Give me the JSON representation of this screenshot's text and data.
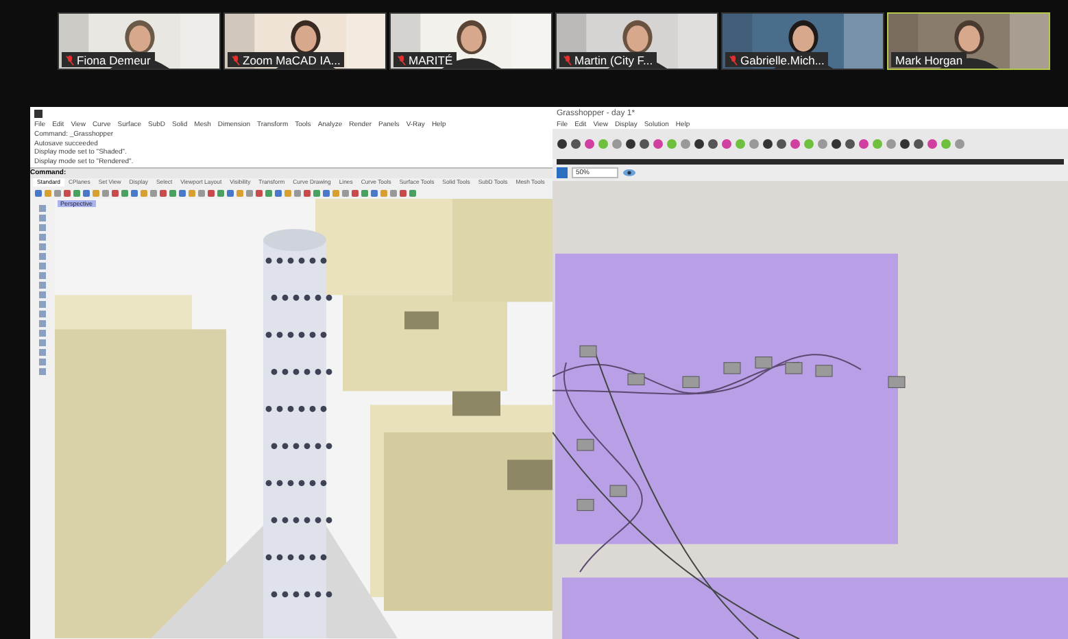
{
  "participants": [
    {
      "name": "Fiona Demeur",
      "muted": true,
      "speaking": false
    },
    {
      "name": "Zoom MaCAD IA...",
      "muted": true,
      "speaking": false
    },
    {
      "name": "MARITÉ",
      "muted": true,
      "speaking": false
    },
    {
      "name": "Martin (City F...",
      "muted": true,
      "speaking": false
    },
    {
      "name": "Gabrielle.Mich...",
      "muted": true,
      "speaking": false
    },
    {
      "name": "Mark Horgan",
      "muted": false,
      "speaking": true
    }
  ],
  "rhino": {
    "menu": [
      "File",
      "Edit",
      "View",
      "Curve",
      "Surface",
      "SubD",
      "Solid",
      "Mesh",
      "Dimension",
      "Transform",
      "Tools",
      "Analyze",
      "Render",
      "Panels",
      "V-Ray",
      "Help"
    ],
    "command_history": [
      "Command: _Grasshopper",
      "Autosave succeeded",
      "Display mode set to \"Shaded\".",
      "Display mode set to \"Rendered\"."
    ],
    "command_prompt": "Command:",
    "tabs": [
      {
        "label": "Standard",
        "selected": true
      },
      {
        "label": "CPlanes",
        "selected": false
      },
      {
        "label": "Set View",
        "selected": false
      },
      {
        "label": "Display",
        "selected": false
      },
      {
        "label": "Select",
        "selected": false
      },
      {
        "label": "Viewport Layout",
        "selected": false
      },
      {
        "label": "Visibility",
        "selected": false
      },
      {
        "label": "Transform",
        "selected": false
      },
      {
        "label": "Curve Drawing",
        "selected": false
      },
      {
        "label": "Lines",
        "selected": false
      },
      {
        "label": "Curve Tools",
        "selected": false
      },
      {
        "label": "Surface Tools",
        "selected": false
      },
      {
        "label": "Solid Tools",
        "selected": false
      },
      {
        "label": "SubD Tools",
        "selected": false
      },
      {
        "label": "Mesh Tools",
        "selected": false
      }
    ],
    "viewport_label": "Perspective"
  },
  "grasshopper": {
    "title": "Grasshopper - day 1*",
    "menu": [
      "File",
      "Edit",
      "View",
      "Display",
      "Solution",
      "Help"
    ],
    "zoom": "50%"
  }
}
